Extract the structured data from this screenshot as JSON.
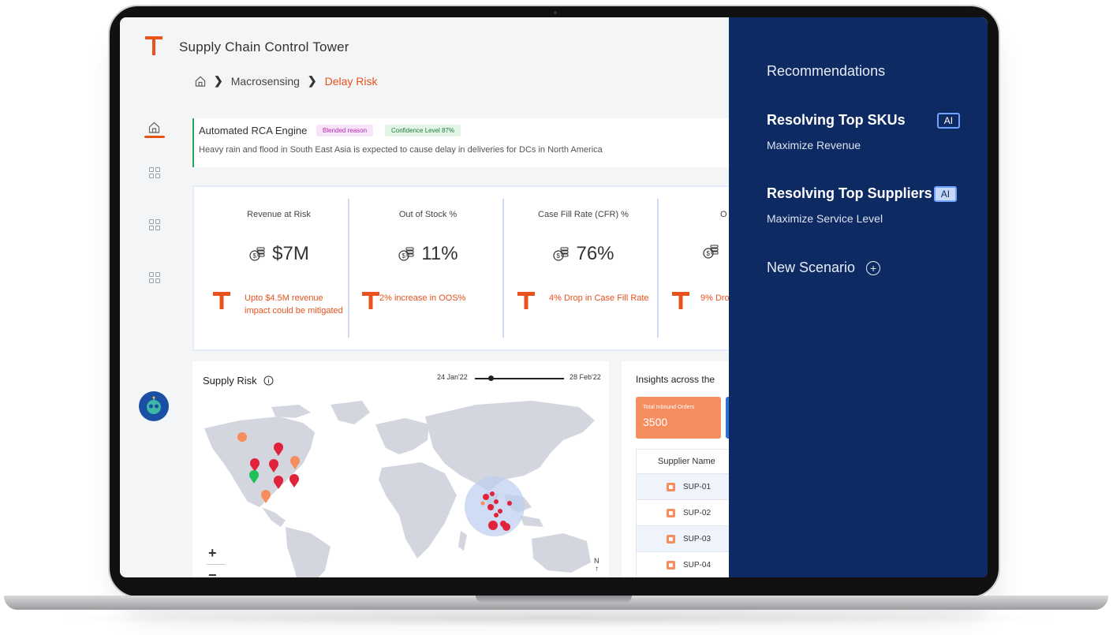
{
  "app": {
    "title": "Supply Chain Control Tower"
  },
  "breadcrumb": {
    "items": [
      "Macrosensing",
      "Delay Risk"
    ]
  },
  "rca": {
    "title": "Automated RCA Engine",
    "badge_reason": "Blended reason",
    "badge_confidence": "Confidence Level 87%",
    "text": "Heavy rain and flood in South East Asia is expected to cause delay in deliveries for DCs in North America"
  },
  "kpis": [
    {
      "label": "Revenue at Risk",
      "value": "$7M",
      "note": "Upto $4.5M revenue impact  could be mitigated"
    },
    {
      "label": "Out of Stock %",
      "value": "11%",
      "note": "2% increase in OOS%"
    },
    {
      "label": "Case Fill Rate (CFR) %",
      "value": "76%",
      "note": "4% Drop in Case Fill Rate"
    },
    {
      "label": "O",
      "value": "",
      "note": "9% Dro"
    }
  ],
  "supply_risk": {
    "title": "Supply Risk",
    "date_start": "24 Jan'22",
    "date_end": "28 Feb'22",
    "zoom_in": "+",
    "zoom_out": "−",
    "north": "N"
  },
  "insights": {
    "title": "Insights across the",
    "tile_label": "Total Inbound Orders",
    "tile_value": "3500",
    "column": "Supplier Name",
    "rows": [
      "SUP-01",
      "SUP-02",
      "SUP-03",
      "SUP-04"
    ]
  },
  "recommendations": {
    "title": "Recommendations",
    "items": [
      {
        "title": "Resolving Top SKUs",
        "badge": "AI",
        "subtitle": "Maximize Revenue"
      },
      {
        "title": "Resolving Top Suppliers",
        "badge": "AI",
        "subtitle": "Maximize Service Level"
      }
    ],
    "new_scenario": "New Scenario"
  },
  "colors": {
    "accent": "#e8521c",
    "panel": "#0e2a63",
    "tile": "#f68d5e"
  }
}
